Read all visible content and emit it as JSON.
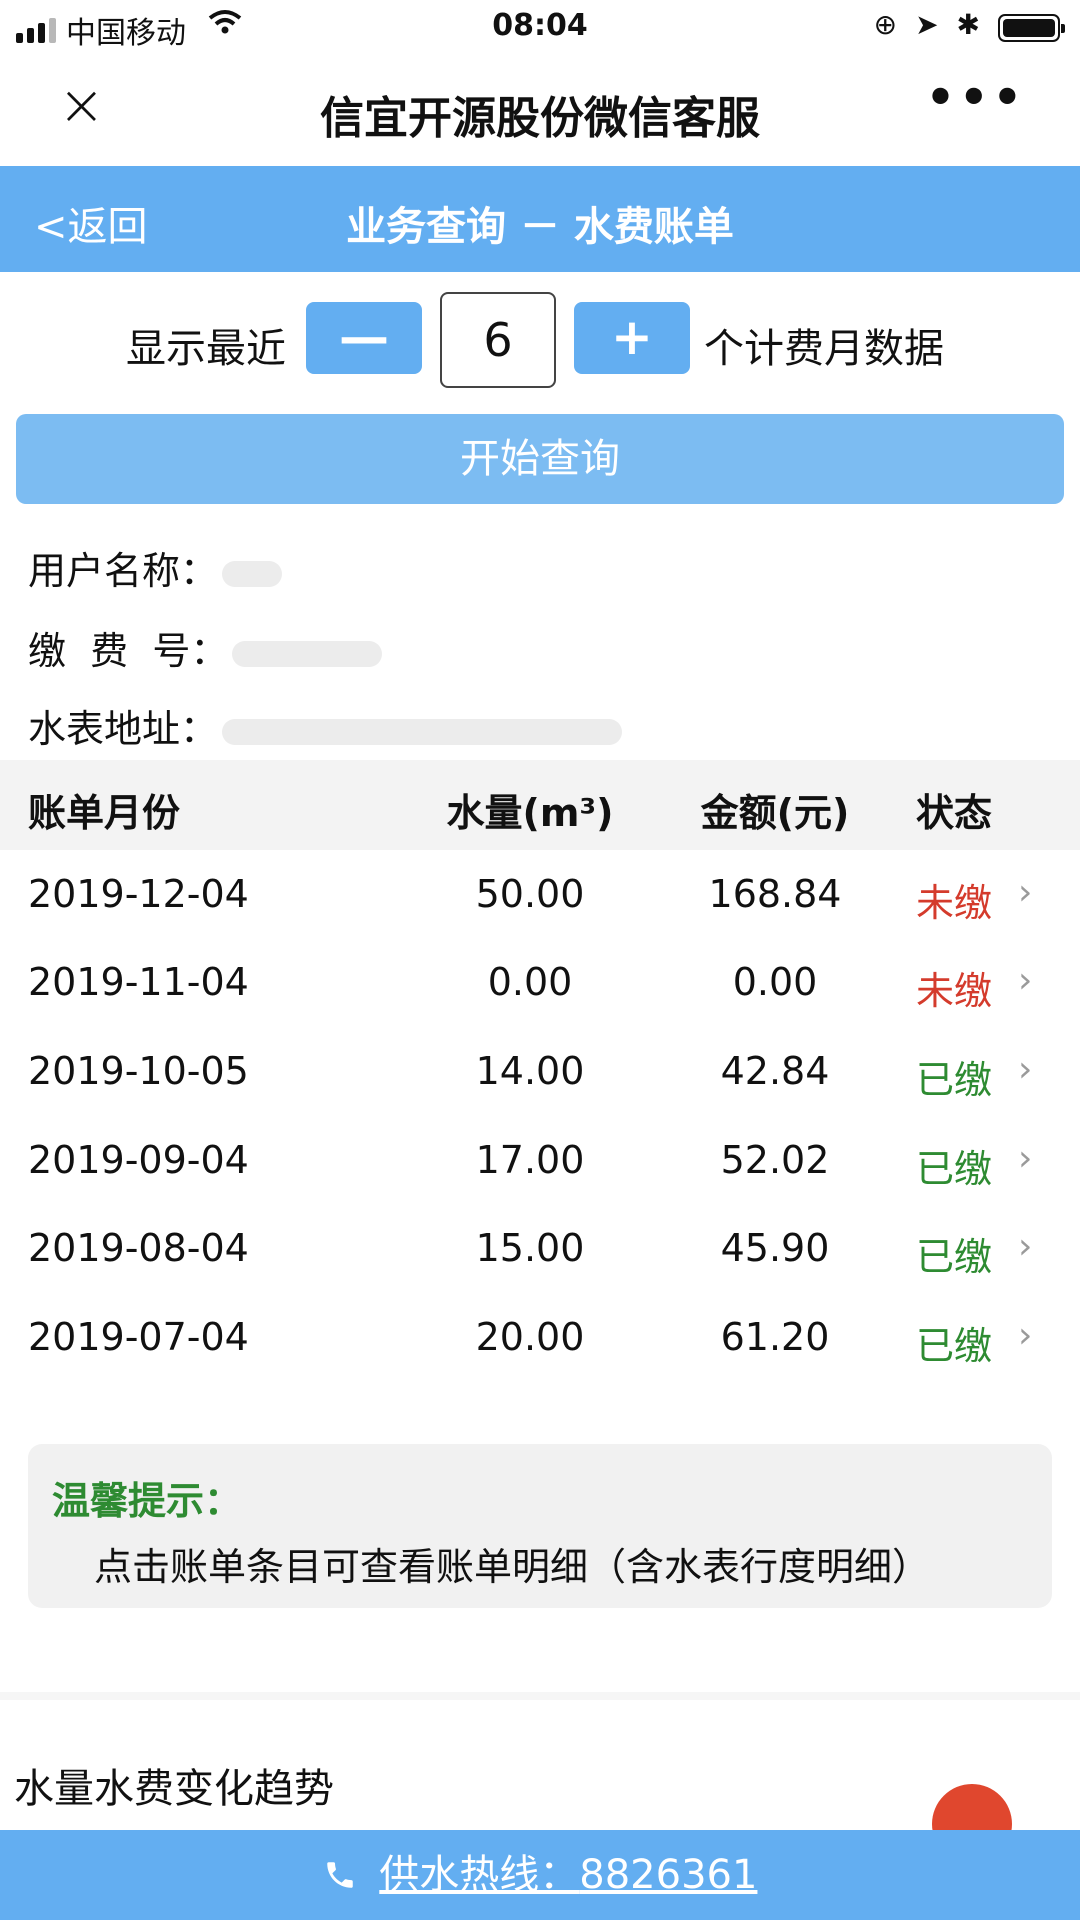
{
  "status_bar": {
    "carrier": "中国移动",
    "time": "08:04"
  },
  "titlebar": {
    "title": "信宜开源股份微信客服",
    "close_glyph": "×",
    "more_glyph": "•••"
  },
  "header": {
    "back_label": "<返回",
    "title": "业务查询 － 水费账单"
  },
  "stepper": {
    "prefix": "显示最近",
    "minus": "—",
    "value": "6",
    "plus": "+",
    "suffix": "个计费月数据"
  },
  "query_button": "开始查询",
  "user_info": {
    "name_label": "用户名称：",
    "account_label": "缴  费  号：",
    "address_label": "水表地址："
  },
  "table": {
    "headers": [
      "账单月份",
      "水量(m³)",
      "金额(元)",
      "状态"
    ],
    "rows": [
      {
        "date": "2019-12-04",
        "volume": "50.00",
        "amount": "168.84",
        "status": "未缴"
      },
      {
        "date": "2019-11-04",
        "volume": "0.00",
        "amount": "0.00",
        "status": "未缴"
      },
      {
        "date": "2019-10-05",
        "volume": "14.00",
        "amount": "42.84",
        "status": "已缴"
      },
      {
        "date": "2019-09-04",
        "volume": "17.00",
        "amount": "52.02",
        "status": "已缴"
      },
      {
        "date": "2019-08-04",
        "volume": "15.00",
        "amount": "45.90",
        "status": "已缴"
      },
      {
        "date": "2019-07-04",
        "volume": "20.00",
        "amount": "61.20",
        "status": "已缴"
      }
    ],
    "arrow_glyph": "›"
  },
  "colors": {
    "unpaid": "#d43b2c",
    "paid": "#2e8b32",
    "accent": "#63aef1"
  },
  "tip": {
    "title": "温馨提示：",
    "text": "点击账单条目可查看账单明细（含水表行度明细）"
  },
  "trend": {
    "title": "水量水费变化趋势"
  },
  "hotline": {
    "label": "供水热线：",
    "number": "8826361"
  }
}
